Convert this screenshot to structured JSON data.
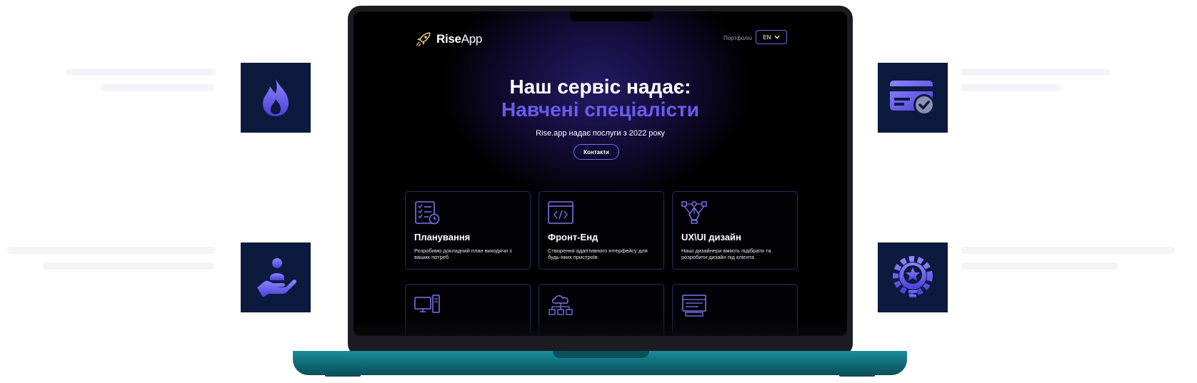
{
  "brand": {
    "name_bold": "Rise",
    "name_light": "App"
  },
  "nav": {
    "portfolio": "Портфоліо",
    "language": "EN"
  },
  "hero": {
    "title": "Наш сервіс надає:",
    "highlight": "Навчені спеціалісти",
    "subtitle": "Rise.app надає послуги з 2022 року",
    "cta": "Контакти"
  },
  "cards": [
    {
      "icon": "checklist-clock-icon",
      "title": "Планування",
      "desc": "Розробимо докладний план виходячи з ваших потреб"
    },
    {
      "icon": "code-window-icon",
      "title": "Фронт-Енд",
      "desc": "Створення адаптивного інтерфейсу для будь-яких пристроїв"
    },
    {
      "icon": "pen-tool-icon",
      "title": "UX\\UI дизайн",
      "desc": "Наші дизайнери вміють підібрати та розробити дизайн під клієнта"
    },
    {
      "icon": "desktop-computer-icon",
      "title": "",
      "desc": ""
    },
    {
      "icon": "cloud-network-icon",
      "title": "",
      "desc": ""
    },
    {
      "icon": "server-rack-icon",
      "title": "",
      "desc": ""
    }
  ],
  "side_tiles": [
    {
      "icon": "fire-icon"
    },
    {
      "icon": "credit-card-check-icon"
    },
    {
      "icon": "hand-person-icon"
    },
    {
      "icon": "gear-star-bulb-icon"
    }
  ],
  "colors": {
    "accent": "#6a5cf0",
    "tile_bg": "#0b1a3d",
    "laptop_base": "#0e6a76",
    "card_border": "#262e63"
  }
}
